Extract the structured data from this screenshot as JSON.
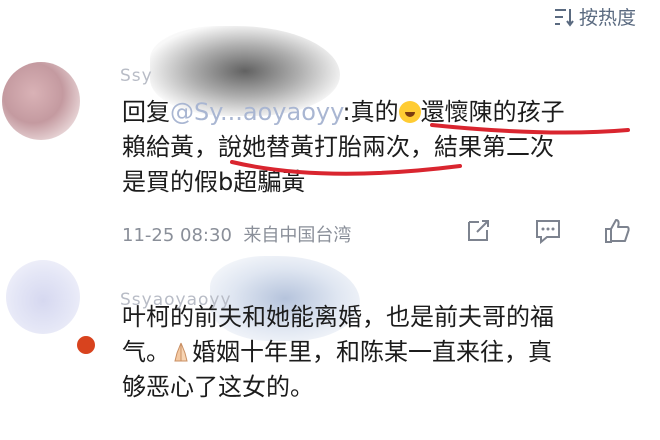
{
  "header": {
    "sort_label": "按热度",
    "sort_icon": "sort-icon"
  },
  "comments": [
    {
      "username": "Ssy",
      "text_line1_prefix": "回复",
      "text_line1_mention": "@Sy...aoyaoyy",
      "text_line1_rest": ":真的",
      "text_line1_after_emoji": "還懷陳的孩子",
      "text_line2": "賴給黃，說她替黃打胎兩次，結果第二次",
      "text_line3": "是買的假b超騙黃",
      "timestamp": "11-25 08:30",
      "source": "来自中国台湾",
      "icons": [
        "share-icon",
        "reply-icon",
        "like-icon"
      ],
      "emoji": "laughing-emoji"
    },
    {
      "username": "Ssyaoyaoyy",
      "text_line1": "叶柯的前夫和她能离婚，也是前夫哥的福",
      "text_line2_prefix": "气。",
      "text_line2_after_emoji": "婚姻十年里，和陈某一直来往，真",
      "text_line3": "够恶心了这女的。",
      "emoji": "praying-hands-emoji"
    }
  ],
  "colors": {
    "underline": "#d9252f",
    "meta": "#8a8f99",
    "sort": "#5a6a80",
    "badge": "#d8431e"
  }
}
